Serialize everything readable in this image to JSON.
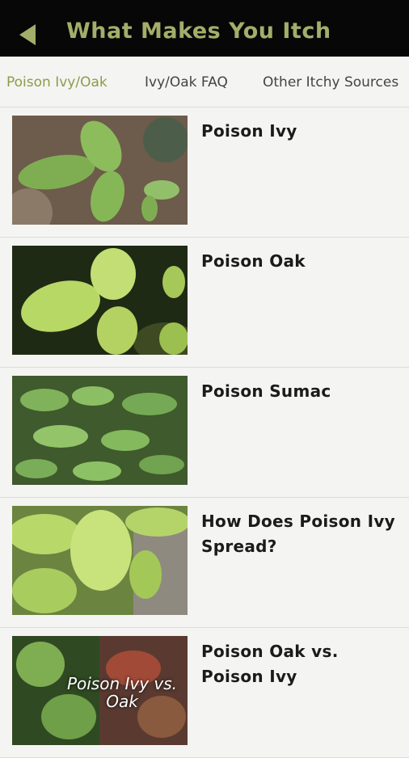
{
  "header": {
    "title": "What Makes You Itch",
    "back_icon": "back-arrow-icon",
    "accent_color": "#a4ad6a"
  },
  "tabs": [
    {
      "label": "Poison Ivy/Oak",
      "active": true
    },
    {
      "label": "Ivy/Oak FAQ",
      "active": false
    },
    {
      "label": "Other Itchy Sources",
      "active": false
    }
  ],
  "items": [
    {
      "title": "Poison Ivy"
    },
    {
      "title": "Poison Oak"
    },
    {
      "title": "Poison Sumac"
    },
    {
      "title": "How Does Poison Ivy Spread?"
    },
    {
      "title": "Poison Oak vs. Poison Ivy",
      "image_caption": "Poison Ivy vs. Oak"
    }
  ]
}
